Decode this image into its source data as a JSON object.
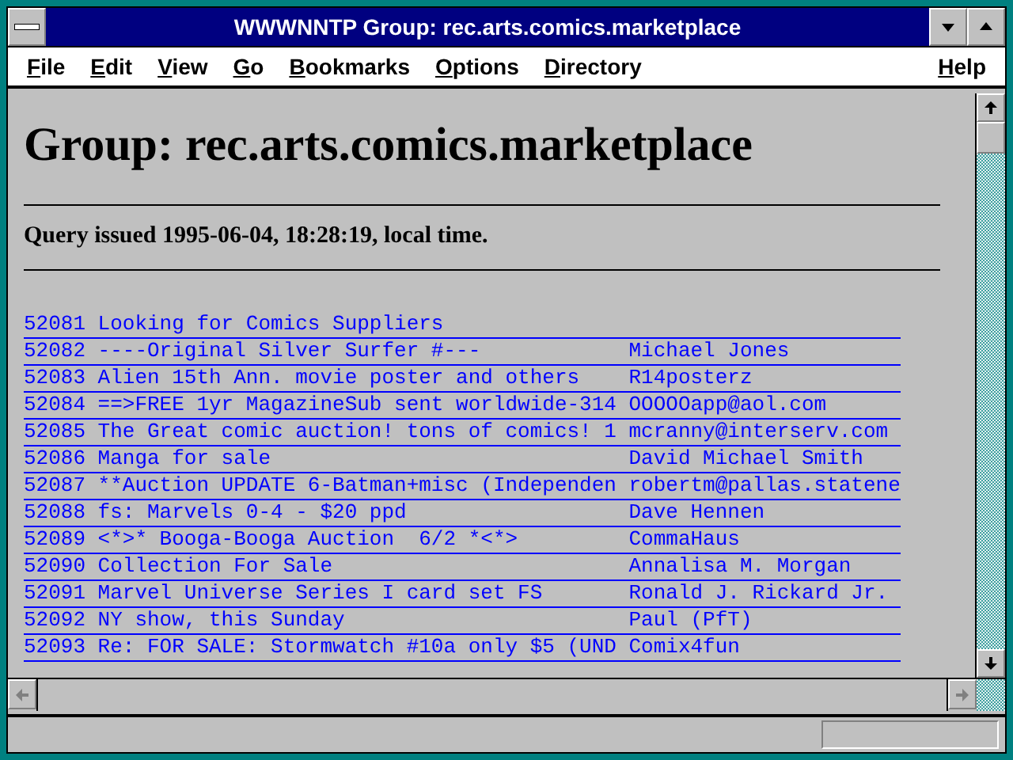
{
  "window": {
    "title": "WWWNNTP Group: rec.arts.comics.marketplace"
  },
  "menu": [
    {
      "label": "File"
    },
    {
      "label": "Edit"
    },
    {
      "label": "View"
    },
    {
      "label": "Go"
    },
    {
      "label": "Bookmarks"
    },
    {
      "label": "Options"
    },
    {
      "label": "Directory"
    },
    {
      "label": "Help"
    }
  ],
  "page": {
    "heading": "Group: rec.arts.comics.marketplace",
    "query": "Query issued 1995-06-04, 18:28:19, local time."
  },
  "articles": [
    {
      "number": "52081",
      "subject": "Looking for Comics Suppliers"
    },
    {
      "number": "52082",
      "subject": "----Original Silver Surfer #---",
      "author": "Michael Jones"
    },
    {
      "number": "52083",
      "subject": "Alien 15th Ann. movie poster and others",
      "author": "R14posterz"
    },
    {
      "number": "52084",
      "subject": "==>FREE 1yr MagazineSub sent worldwide-314",
      "author": "OOOOOapp@aol.com"
    },
    {
      "number": "52085",
      "subject": "The Great comic auction! tons of comics! 1",
      "author": "mcranny@interserv.com"
    },
    {
      "number": "52086",
      "subject": "Manga for sale",
      "author": "David Michael Smith"
    },
    {
      "number": "52087",
      "subject": "**Auction UPDATE 6-Batman+misc (Independen",
      "author": "robertm@pallas.statene"
    },
    {
      "number": "52088",
      "subject": "fs: Marvels 0-4 - $20 ppd",
      "author": "Dave Hennen"
    },
    {
      "number": "52089",
      "subject": "<*>* Booga-Booga Auction  6/2 *<*>",
      "author": "CommaHaus"
    },
    {
      "number": "52090",
      "subject": "Collection For Sale",
      "author": "Annalisa M. Morgan"
    },
    {
      "number": "52091",
      "subject": "Marvel Universe Series I card set FS",
      "author": "Ronald J. Rickard Jr."
    },
    {
      "number": "52092",
      "subject": "NY show, this Sunday",
      "author": "Paul (PfT)"
    },
    {
      "number": "52093",
      "subject": "Re: FOR SALE: Stormwatch #10a only $5 (UND",
      "author": "Comix4fun"
    }
  ]
}
